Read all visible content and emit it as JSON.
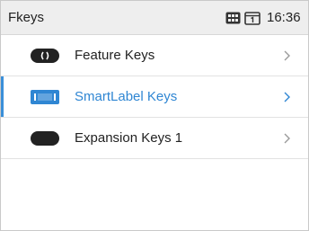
{
  "statusbar": {
    "title": "Fkeys",
    "time": "16:36",
    "icons": [
      "keypad-status-icon",
      "handset-status-icon"
    ]
  },
  "list": {
    "items": [
      {
        "label": "Feature Keys",
        "icon": "feature-keys-icon",
        "selected": false
      },
      {
        "label": "SmartLabel Keys",
        "icon": "smartlabel-keys-icon",
        "selected": true
      },
      {
        "label": "Expansion Keys 1",
        "icon": "expansion-keys-icon",
        "selected": false
      }
    ]
  },
  "colors": {
    "accent": "#2f86d3",
    "statusbar_bg": "#eeeeee",
    "text": "#222222",
    "chevron": "#9a9a9a"
  }
}
